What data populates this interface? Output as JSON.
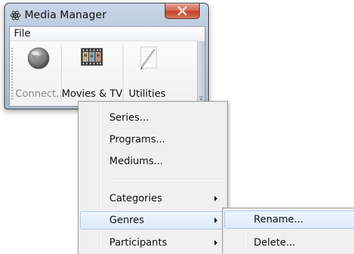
{
  "window": {
    "title": "Media Manager",
    "app_icon": "atom-icon",
    "close_icon": "close-icon"
  },
  "menubar": {
    "items": [
      {
        "label": "File"
      }
    ]
  },
  "toolbar": {
    "buttons": [
      {
        "label": "Connect...",
        "icon": "globe-icon",
        "enabled": false
      },
      {
        "label": "Movies & TV",
        "icon": "film-strip-icon",
        "enabled": true
      },
      {
        "label": "Utilities",
        "icon": "notepad-pen-icon",
        "enabled": true
      }
    ],
    "overflow_icon": "chevron-down-icon"
  },
  "dropdown": {
    "items": [
      {
        "label": "Series...",
        "has_submenu": false
      },
      {
        "label": "Programs...",
        "has_submenu": false
      },
      {
        "label": "Mediums...",
        "has_submenu": false
      },
      {
        "label": "Categories",
        "has_submenu": true
      },
      {
        "label": "Genres",
        "has_submenu": true,
        "highlighted": true
      },
      {
        "label": "Participants",
        "has_submenu": true
      }
    ]
  },
  "submenu": {
    "items": [
      {
        "label": "Rename...",
        "highlighted": true
      },
      {
        "label": "Delete..."
      }
    ]
  },
  "colors": {
    "highlight": "#dcebfc",
    "highlight_border": "#a8c8ec",
    "close_button": "#c0412a",
    "disabled_text": "#8a8a8a"
  }
}
